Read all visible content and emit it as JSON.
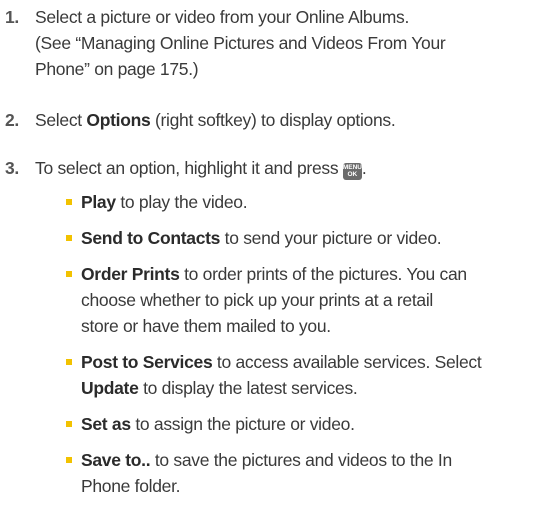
{
  "steps": [
    {
      "number": "1.",
      "lines": [
        "Select a picture or video from your Online Albums.",
        "(See “Managing Online Pictures and Videos From Your",
        "Phone” on page 175.)"
      ]
    },
    {
      "number": "2.",
      "pre": "Select ",
      "bold": "Options",
      "post": " (right softkey) to display options."
    },
    {
      "number": "3.",
      "text": "To select an option, highlight it and press",
      "key_top": "MENU",
      "key_bottom": "OK",
      "after_key": "."
    }
  ],
  "options": [
    {
      "bold": "Play",
      "text": " to play the video."
    },
    {
      "bold": "Send to Contacts",
      "text": " to send your picture or video."
    },
    {
      "bold": "Order Prints",
      "text": " to order prints of the pictures. You can",
      "line2": "choose whether to pick up your prints at a retail",
      "line3": "store or have them mailed to you."
    },
    {
      "bold": "Post to Services",
      "text": " to access available services. Select",
      "line2_bold": "Update",
      "line2_text": " to display the latest services."
    },
    {
      "bold": "Set as",
      "text": " to assign the picture or video."
    },
    {
      "bold": "Save to..",
      "text": " to save the pictures and videos to the In",
      "line2": "Phone folder."
    }
  ],
  "colors": {
    "text": "#3a3a3a",
    "bullet": "#f2c200",
    "key": "#6b6b6b"
  }
}
